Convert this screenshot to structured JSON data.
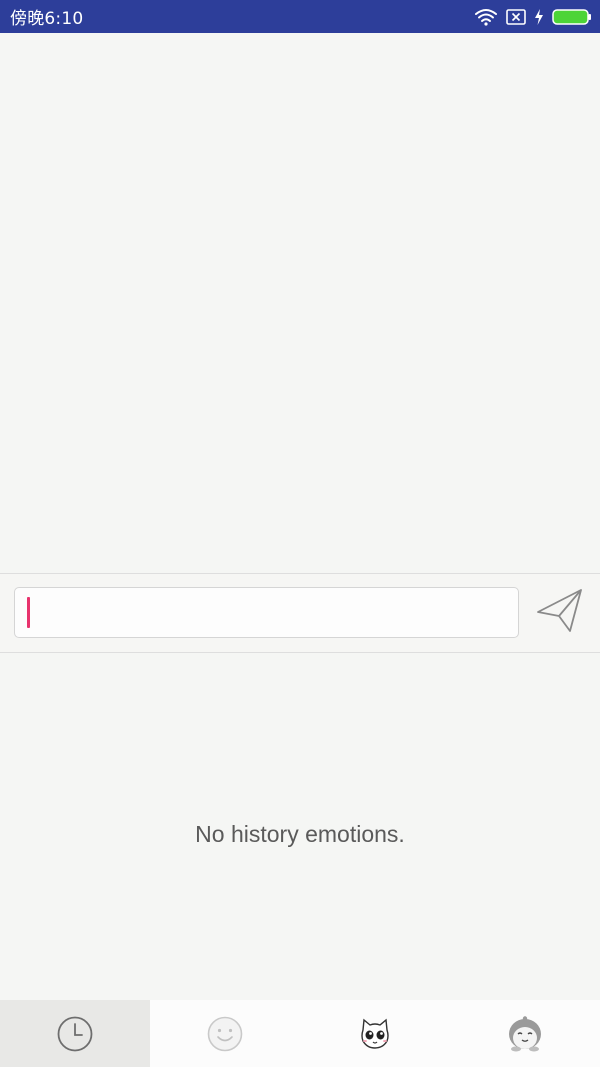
{
  "status_bar": {
    "time": "傍晚6:10",
    "icons": [
      "wifi-icon",
      "sim-disabled-icon",
      "charging-icon",
      "battery-icon"
    ],
    "background_color": "#2d3e9a",
    "battery_color": "#4cd437"
  },
  "input": {
    "value": "",
    "placeholder": "",
    "cursor_color": "#e8336d"
  },
  "send_button": {
    "icon": "send-icon"
  },
  "emotion_panel": {
    "empty_text": "No history emotions."
  },
  "tabs": [
    {
      "icon": "history-clock-icon",
      "active": true
    },
    {
      "icon": "smiley-face-icon",
      "active": false
    },
    {
      "icon": "cat-sticker-icon",
      "active": false
    },
    {
      "icon": "penguin-sticker-icon",
      "active": false
    }
  ]
}
